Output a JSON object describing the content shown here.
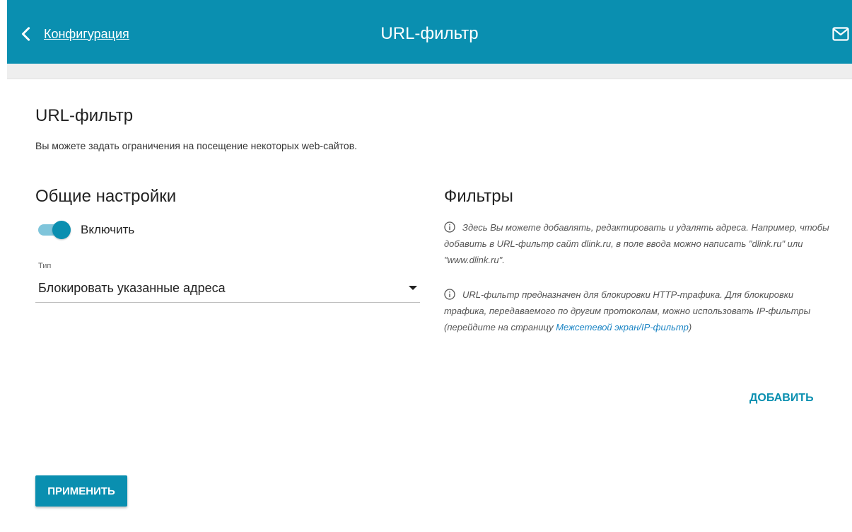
{
  "header": {
    "back_label": "Конфигурация",
    "title": "URL-фильтр",
    "icons": {
      "back": "chevron-left-icon",
      "mail": "mail-icon"
    }
  },
  "page": {
    "title": "URL-фильтр",
    "description": "Вы можете задать ограничения на посещение некоторых web-сайтов."
  },
  "general": {
    "title": "Общие настройки",
    "enable_label": "Включить",
    "enabled": true,
    "type_label": "Тип",
    "type_value": "Блокировать указанные адреса"
  },
  "filters": {
    "title": "Фильтры",
    "info1": "Здесь Вы можете добавлять, редактировать и удалять адреса. Например, чтобы добавить в URL-фильтр сайт dlink.ru, в поле ввода можно написать \"dlink.ru\" или \"www.dlink.ru\".",
    "info2_text": "URL-фильтр предназначен для блокировки HTTP-трафика. Для блокировки трафика, передаваемого по другим протоколам, можно использовать IP-фильтры (перейдите на страницу ",
    "info2_link": "Межсетевой экран/IP-фильтр",
    "info2_tail": ")",
    "add_label": "ДОБАВИТЬ"
  },
  "actions": {
    "apply_label": "ПРИМЕНИТЬ"
  },
  "colors": {
    "accent": "#0a8fb0",
    "link": "#1a84c4"
  }
}
